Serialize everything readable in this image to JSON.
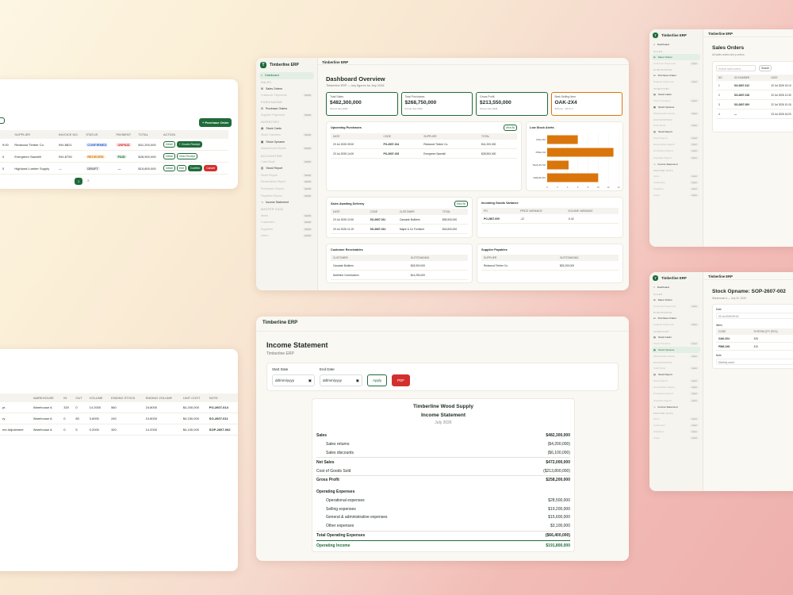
{
  "app": {
    "name": "Timberline ERP",
    "logo_letter": "T"
  },
  "nav": {
    "dashboard": "Dashboard",
    "sales_section": "SALES",
    "sales_orders": "Sales Orders",
    "customer_payments": "Customer Payments",
    "purchasing_section": "PURCHASING",
    "purchase_orders": "Purchase Orders",
    "supplier_payments": "Supplier Payments",
    "inventory_section": "INVENTORY",
    "stock_cards": "Stock Cards",
    "stock_transfers": "Stock Transfers",
    "stock_opname": "Stock Opname",
    "wasted_stock": "Wasted/sold Stocks",
    "accounting_section": "ACCOUNTING",
    "cash_book": "Cash Book",
    "stock_report": "Stock Report",
    "stock_report_sub": "Stock Report",
    "receivables_report": "Receivables Report",
    "purchases_report": "Purchases Report",
    "payables_report": "Payables Report",
    "income_statement": "Income Statement",
    "master_section": "MASTER DATA",
    "items": "Items",
    "customers": "Customers",
    "suppliers": "Suppliers",
    "users": "Users",
    "soon": "soon"
  },
  "dashboard": {
    "title": "Dashboard Overview",
    "subtitle": "Timberline ERP — key figures for July 2026",
    "kpis": [
      {
        "label": "Total Sales",
        "value": "$482,300,000",
        "sub": "Period July 2026"
      },
      {
        "label": "Total Purchases",
        "value": "$268,750,000",
        "sub": "Period July 2026"
      },
      {
        "label": "Gross Profit",
        "value": "$213,550,000",
        "sub": "Period July 2026"
      },
      {
        "label": "Best-Selling Item",
        "value": "OAK-2X4",
        "sub": "320 pcs · 99.9 m³"
      }
    ],
    "upcoming": {
      "title": "Upcoming Purchases",
      "view_all": "View All",
      "columns": [
        "DATE",
        "CODE",
        "SUPPLIER",
        "TOTAL"
      ],
      "rows": [
        [
          "20 Jul 2026 09:00",
          "PO-2607-014",
          "Redwood Timber Co.",
          "$41,200,000"
        ],
        [
          "20 Jul 2026 14:00",
          "PO-2607-015",
          "Evergreen Sawmill",
          "$28,900,000"
        ]
      ]
    },
    "low_stock": {
      "title": "Low Stock Alerts",
      "categories": [
        "OAK-2X4",
        "PINE-1X6",
        "TEAK-PLY18",
        "CEDAR-4X4"
      ],
      "ticks": [
        "0",
        "2",
        "4",
        "6",
        "8",
        "10",
        "12",
        "14"
      ]
    },
    "awaiting": {
      "title": "Sales Awaiting Delivery",
      "view_all": "View All",
      "columns": [
        "DATE",
        "CODE",
        "CUSTOMER",
        "TOTAL"
      ],
      "rows": [
        [
          "20 Jul 2026 10:30",
          "SO-2607-011",
          "Cascade Builders",
          "$36,500,000"
        ],
        [
          "20 Jul 2026 11:15",
          "SO-2607-012",
          "Maple & Co Furniture",
          "$18,800,000"
        ]
      ]
    },
    "incoming": {
      "title": "Incoming Goods Variance",
      "columns": [
        "PO",
        "PRICE VARIANCE",
        "VOLUME VARIANCE"
      ],
      "rows": [
        [
          "PO-2607-009",
          "-12",
          "-0.42"
        ]
      ]
    },
    "receivables": {
      "title": "Customer Receivables",
      "columns": [
        "CUSTOMER",
        "OUTSTANDING"
      ],
      "rows": [
        [
          "Cascade Builders",
          "$18,500,000"
        ],
        [
          "Northline Construction",
          "$14,250,000"
        ]
      ]
    },
    "payables": {
      "title": "Supplier Payables",
      "columns": [
        "SUPPLIER",
        "OUTSTANDING"
      ],
      "rows": [
        [
          "Redwood Timber Co.",
          "$25,200,000"
        ]
      ]
    }
  },
  "purchase_list": {
    "new_button": "+ Purchase Order",
    "columns": [
      "",
      "SUPPLIER",
      "INVOICE NO.",
      "STATUS",
      "PAYMENT",
      "TOTAL",
      "ACTION"
    ],
    "rows": [
      {
        "date": "9:00",
        "supplier": "Redwood Timber Co.",
        "invoice": "INV-8821",
        "status": "CONFIRMED",
        "payment": "UNPAID",
        "total": "$41,200,000",
        "actions": [
          "Detail",
          "+ Goods Receipt"
        ]
      },
      {
        "date": "0",
        "supplier": "Evergreen Sawmill",
        "invoice": "INV-8790",
        "status": "RECEIVED",
        "payment": "PAID",
        "total": "$28,900,000",
        "actions": [
          "Detail",
          "View Receipt"
        ]
      },
      {
        "date": "0",
        "supplier": "Highland Lumber Supply",
        "invoice": "—",
        "status": "DRAFT",
        "payment": "—",
        "total": "$15,600,000",
        "actions": [
          "Detail",
          "Edit",
          "Confirm",
          "Cancel"
        ]
      }
    ],
    "pages": [
      "1",
      "2"
    ]
  },
  "stock_list": {
    "columns": [
      "",
      "WAREHOUSE",
      "IN",
      "OUT",
      "VOLUME",
      "ENDING STOCK",
      "ENDING VOLUME",
      "UNIT COST",
      "NOTE"
    ],
    "rows": [
      [
        "pt",
        "Warehouse A",
        "320",
        "0",
        "14.2000",
        "560",
        "24.8000",
        "$4,200,000",
        "PO-2607-014"
      ],
      [
        "ry",
        "Warehouse A",
        "0",
        "80",
        "3.6000",
        "240",
        "10.8000",
        "$4,150,000",
        "SO-2607-011"
      ],
      [
        "me Adjustment",
        "Warehouse A",
        "0",
        "5",
        "0.2000",
        "320",
        "14.2000",
        "$4,100,000",
        "SOP-2607-002"
      ]
    ]
  },
  "income": {
    "page_title": "Income Statement",
    "page_subtitle": "Timberline ERP",
    "start_label": "Start Date",
    "end_label": "End Date",
    "date_placeholder": "dd/mm/yyyy",
    "apply": "Apply",
    "pdf": "PDF",
    "company": "Timberline Wood Supply",
    "doc_title": "Income Statement",
    "period": "July 2026",
    "lines": [
      {
        "label": "Sales",
        "amount": "$482,300,000",
        "cls": "strong"
      },
      {
        "label": "Sales returns",
        "amount": "($4,200,000)",
        "cls": "indent mid"
      },
      {
        "label": "Sales discounts",
        "amount": "($6,100,000)",
        "cls": "indent mid"
      },
      {
        "label": "Net Sales",
        "amount": "$472,000,000",
        "cls": "strong rule"
      },
      {
        "label": "Cost of Goods Sold",
        "amount": "($213,800,000)",
        "cls": "mid"
      },
      {
        "label": "Gross Profit",
        "amount": "$258,200,000",
        "cls": "strong rule"
      },
      {
        "label": "Operating Expenses",
        "amount": "",
        "cls": "strong gap"
      },
      {
        "label": "Operational expenses",
        "amount": "$28,500,000",
        "cls": "indent mid"
      },
      {
        "label": "Selling expenses",
        "amount": "$19,200,000",
        "cls": "indent mid"
      },
      {
        "label": "General & administrative expenses",
        "amount": "$15,600,000",
        "cls": "indent mid"
      },
      {
        "label": "Other expenses",
        "amount": "$3,100,000",
        "cls": "indent mid"
      },
      {
        "label": "Total Operating Expenses",
        "amount": "($66,400,000)",
        "cls": "strong rule"
      },
      {
        "label": "Operating Income",
        "amount": "$191,800,000",
        "cls": "final"
      }
    ]
  },
  "sales_orders": {
    "title": "Sales Orders",
    "subtitle": "All sales orders and p orders",
    "search_placeholder": "Search sales orders",
    "search_button": "Search",
    "columns": [
      "NO",
      "SO NUMBER",
      "DATE"
    ],
    "rows": [
      [
        "1",
        "SO-2607-012",
        "20 Jul 2026 15:10"
      ],
      [
        "2",
        "SO-2607-018",
        "20 Jul 2026 12:30"
      ],
      [
        "3",
        "SO-2607-009",
        "22 Jul 2026 10:15"
      ],
      [
        "4",
        "—",
        "23 Jul 2026 16:20"
      ]
    ]
  },
  "opname": {
    "title": "Stock Opname: SOP-2607-002",
    "subtitle": "Warehouse A — July 20, 2026",
    "date_label": "Date",
    "date_value": "20 Jul 2026 09:15",
    "items_label": "Items",
    "columns": [
      "CODE",
      "SYSTEM QTY (PCS)"
    ],
    "rows": [
      [
        "OAK-2X4",
        "326"
      ],
      [
        "PINE-1X6",
        "310"
      ]
    ],
    "note_label": "Note",
    "note_value": "Monthly count"
  },
  "colors": {
    "brand": "#1f6b3a",
    "bar": "#d9750b",
    "danger": "#d32f2f"
  }
}
